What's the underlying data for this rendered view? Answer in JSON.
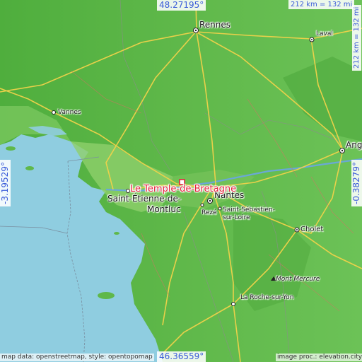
{
  "map": {
    "highlight_label": "Le Temple-de-Bretagne",
    "coords": {
      "top": "48.27195°",
      "bottom": "46.36559°",
      "left": "-3.19529°",
      "right": "-0.38279°"
    },
    "scale": {
      "top": "212 km = 132 mi",
      "right": "212 km = 132 mi"
    },
    "credits": {
      "left": "map data: openstreetmap, style: opentopomap",
      "right": "image proc.: elevation.city"
    },
    "cities": {
      "rennes": "Rennes",
      "laval": "Laval",
      "vannes": "Vannes",
      "angers": "Angers",
      "nantes": "Nantes",
      "saint_etienne": "Saint-Étienne-de-",
      "montluc": "Montluc",
      "reze": "Rezé",
      "saint_sebastien": "Saint-Sébastien-",
      "sur_loire": "sur-Loire",
      "cholet": "Cholet",
      "mont_mercure": "Mont Mercure",
      "la_roche": "La Roche-sur-Yon"
    },
    "colors": {
      "sea": "#8fcde0",
      "land": "#5fb84a",
      "land_light": "#8fcf6a",
      "road": "#f0d24a",
      "highlight": "#e6233e",
      "coord_text": "#3a5bd9"
    }
  }
}
